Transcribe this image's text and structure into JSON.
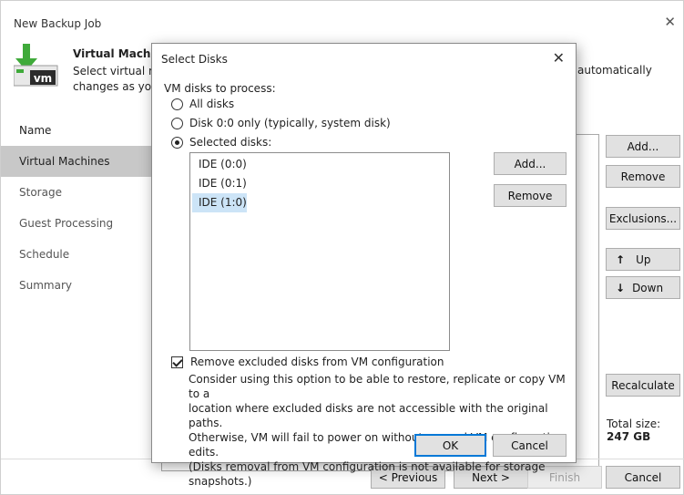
{
  "window": {
    "title": "New Backup Job",
    "close_glyph": "✕"
  },
  "header": {
    "title": "Virtual Machine",
    "desc_line1": "Select virtual ma",
    "desc_line2": "changes as you a",
    "desc_right": "automatically",
    "icon": "vm-download-icon",
    "icon_text": "vm"
  },
  "sidebar": {
    "items": [
      {
        "label": "Name"
      },
      {
        "label": "Virtual Machines"
      },
      {
        "label": "Storage"
      },
      {
        "label": "Guest Processing"
      },
      {
        "label": "Schedule"
      },
      {
        "label": "Summary"
      }
    ]
  },
  "right_buttons": {
    "add": "Add...",
    "remove": "Remove",
    "exclusions": "Exclusions...",
    "up": "Up",
    "down": "Down",
    "recalculate": "Recalculate",
    "up_glyph": "↑",
    "down_glyph": "↓"
  },
  "total": {
    "label": "Total size:",
    "value": "247 GB"
  },
  "footer": {
    "previous": "< Previous",
    "next": "Next >",
    "finish": "Finish",
    "cancel": "Cancel"
  },
  "dialog": {
    "title": "Select Disks",
    "close_glyph": "✕",
    "label": "VM disks to process:",
    "options": [
      {
        "label": "All disks",
        "checked": false
      },
      {
        "label": "Disk 0:0 only (typically, system disk)",
        "checked": false
      },
      {
        "label": "Selected disks:",
        "checked": true
      }
    ],
    "disks": [
      {
        "label": "IDE (0:0)",
        "selected": false
      },
      {
        "label": "IDE (0:1)",
        "selected": false
      },
      {
        "label": "IDE (1:0)",
        "selected": true
      }
    ],
    "add_button": "Add...",
    "remove_button": "Remove",
    "checkbox_label": "Remove excluded disks from VM configuration",
    "checkbox_checked": true,
    "desc": [
      "Consider using this option to be able to restore, replicate or copy VM to a",
      "location where excluded disks are not accessible with the original paths.",
      "Otherwise, VM will fail to power on without manual VM configuration edits.",
      "(Disks removal from VM configuration is not available for storage snapshots.)"
    ],
    "ok_button": "OK",
    "cancel_button": "Cancel"
  },
  "colors": {
    "accent": "#0078d7",
    "icon_green": "#3faa3a",
    "selection": "#cce4f7",
    "sidebar_active": "#c8c8c8"
  }
}
